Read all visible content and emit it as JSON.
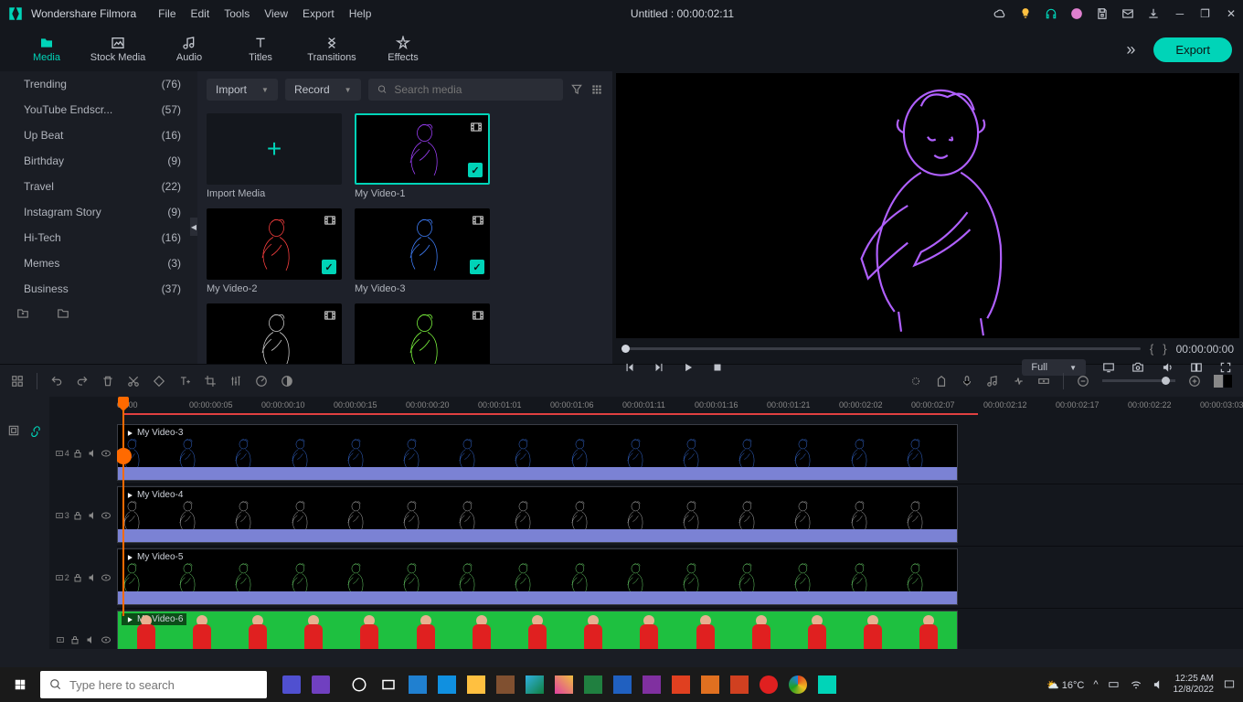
{
  "app_name": "Wondershare Filmora",
  "menu": [
    "File",
    "Edit",
    "Tools",
    "View",
    "Export",
    "Help"
  ],
  "title_center": "Untitled : 00:00:02:11",
  "export_label": "Export",
  "tabs": [
    {
      "label": "Media",
      "active": true
    },
    {
      "label": "Stock Media",
      "active": false
    },
    {
      "label": "Audio",
      "active": false
    },
    {
      "label": "Titles",
      "active": false
    },
    {
      "label": "Transitions",
      "active": false
    },
    {
      "label": "Effects",
      "active": false
    }
  ],
  "sidebar": {
    "items": [
      {
        "label": "Trending",
        "count": "(76)"
      },
      {
        "label": "YouTube Endscr...",
        "count": "(57)"
      },
      {
        "label": "Up Beat",
        "count": "(16)"
      },
      {
        "label": "Birthday",
        "count": "(9)"
      },
      {
        "label": "Travel",
        "count": "(22)"
      },
      {
        "label": "Instagram Story",
        "count": "(9)"
      },
      {
        "label": "Hi-Tech",
        "count": "(16)"
      },
      {
        "label": "Memes",
        "count": "(3)"
      },
      {
        "label": "Business",
        "count": "(37)"
      }
    ]
  },
  "media_toolbar": {
    "import": "Import",
    "record": "Record",
    "search_placeholder": "Search media"
  },
  "media_items": [
    {
      "label": "Import Media",
      "type": "import"
    },
    {
      "label": "My Video-1",
      "type": "video",
      "selected": true,
      "checked": true,
      "color": "#a040ff"
    },
    {
      "label": "My Video-2",
      "type": "video",
      "selected": false,
      "checked": true,
      "color": "#ff4040"
    },
    {
      "label": "My Video-3",
      "type": "video",
      "selected": false,
      "checked": true,
      "color": "#4080ff"
    },
    {
      "label": "",
      "type": "video",
      "selected": false,
      "checked": false,
      "color": "#d0d0d0"
    },
    {
      "label": "",
      "type": "video",
      "selected": false,
      "checked": false,
      "color": "#80ff40"
    }
  ],
  "preview": {
    "timecode": "00:00:00:00",
    "quality": "Full"
  },
  "ruler_ticks": [
    "00:00",
    "00:00:00:05",
    "00:00:00:10",
    "00:00:00:15",
    "00:00:00:20",
    "00:00:01:01",
    "00:00:01:06",
    "00:00:01:11",
    "00:00:01:16",
    "00:00:01:21",
    "00:00:02:02",
    "00:00:02:07",
    "00:00:02:12",
    "00:00:02:17",
    "00:00:02:22",
    "00:00:03:03"
  ],
  "tracks": [
    {
      "num": "4",
      "clip_label": "My Video-3",
      "color": "#4080ff"
    },
    {
      "num": "3",
      "clip_label": "My Video-4",
      "color": "#d0d0d0"
    },
    {
      "num": "2",
      "clip_label": "My Video-5",
      "color": "#80ff80"
    },
    {
      "num": "",
      "clip_label": "My Video-6",
      "color": "green"
    }
  ],
  "taskbar": {
    "search_placeholder": "Type here to search",
    "weather": "16°C",
    "time": "12:25 AM",
    "date": "12/8/2022"
  }
}
